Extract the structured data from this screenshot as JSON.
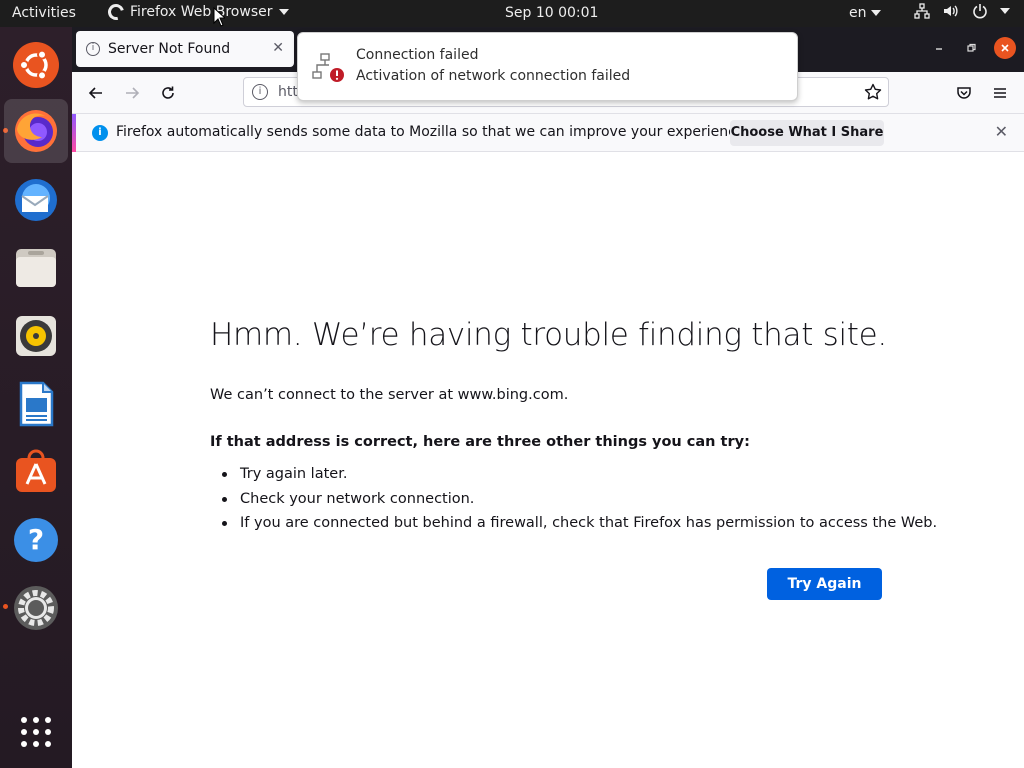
{
  "topbar": {
    "activities": "Activities",
    "app_name": "Firefox Web Browser",
    "clock": "Sep 10  00:01",
    "language": "en",
    "icons": [
      "network-icon",
      "volume-icon",
      "power-icon"
    ]
  },
  "dock": {
    "items": [
      {
        "name": "ubuntu-logo-icon",
        "active": false,
        "running": false
      },
      {
        "name": "firefox-icon",
        "active": true,
        "running": true
      },
      {
        "name": "thunderbird-icon",
        "active": false,
        "running": false
      },
      {
        "name": "files-icon",
        "active": false,
        "running": false
      },
      {
        "name": "rhythmbox-icon",
        "active": false,
        "running": false
      },
      {
        "name": "libreoffice-writer-icon",
        "active": false,
        "running": false
      },
      {
        "name": "software-center-icon",
        "active": false,
        "running": false
      },
      {
        "name": "help-icon",
        "active": false,
        "running": false
      },
      {
        "name": "settings-icon",
        "active": false,
        "running": true
      }
    ],
    "show_apps": "show-applications-icon"
  },
  "browser": {
    "tab_title": "Server Not Found",
    "url_visible": "htt",
    "notification": {
      "text": "Firefox automatically sends some data to Mozilla so that we can improve your experience.",
      "button": "Choose What I Share"
    }
  },
  "popup": {
    "title": "Connection failed",
    "body": "Activation of network connection failed"
  },
  "error_page": {
    "title": "Hmm. We’re having trouble finding that site.",
    "description": "We can’t connect to the server at www.bing.com.",
    "subtitle": "If that address is correct, here are three other things you can try:",
    "suggestions": [
      "Try again later.",
      "Check your network connection.",
      "If you are connected but behind a firewall, check that Firefox has permission to access the Web."
    ],
    "button": "Try Again"
  },
  "colors": {
    "ubuntu_orange": "#e95420",
    "firefox_blue": "#0061e0",
    "dock_bg": "#2b1f28",
    "topbar_bg": "#1d1d1d"
  }
}
